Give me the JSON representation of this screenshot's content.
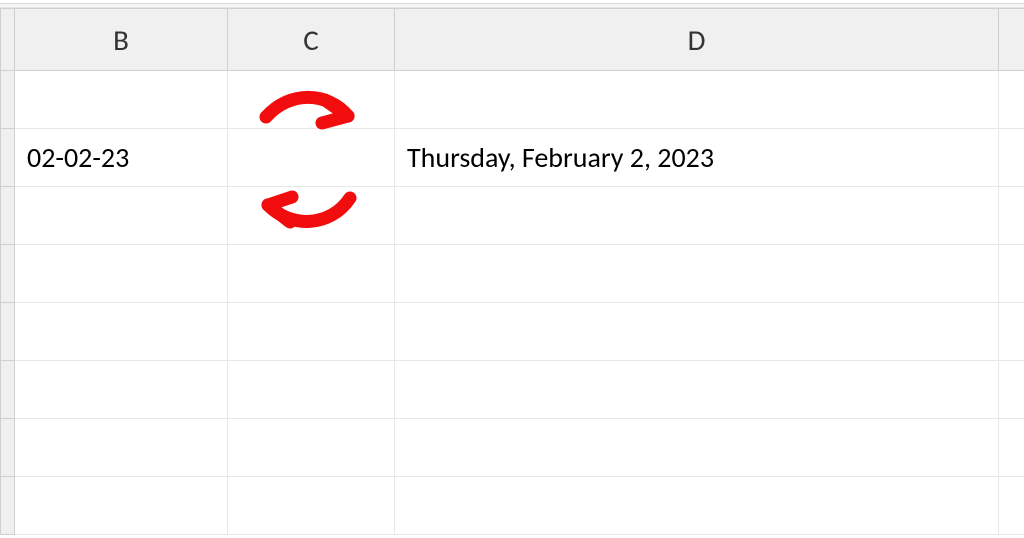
{
  "columns": {
    "B": "B",
    "C": "C",
    "D": "D"
  },
  "cells": {
    "B2": "02-02-23",
    "D2": "Thursday, February 2, 2023"
  },
  "annotations": {
    "arrow_color": "#f10d0d"
  }
}
